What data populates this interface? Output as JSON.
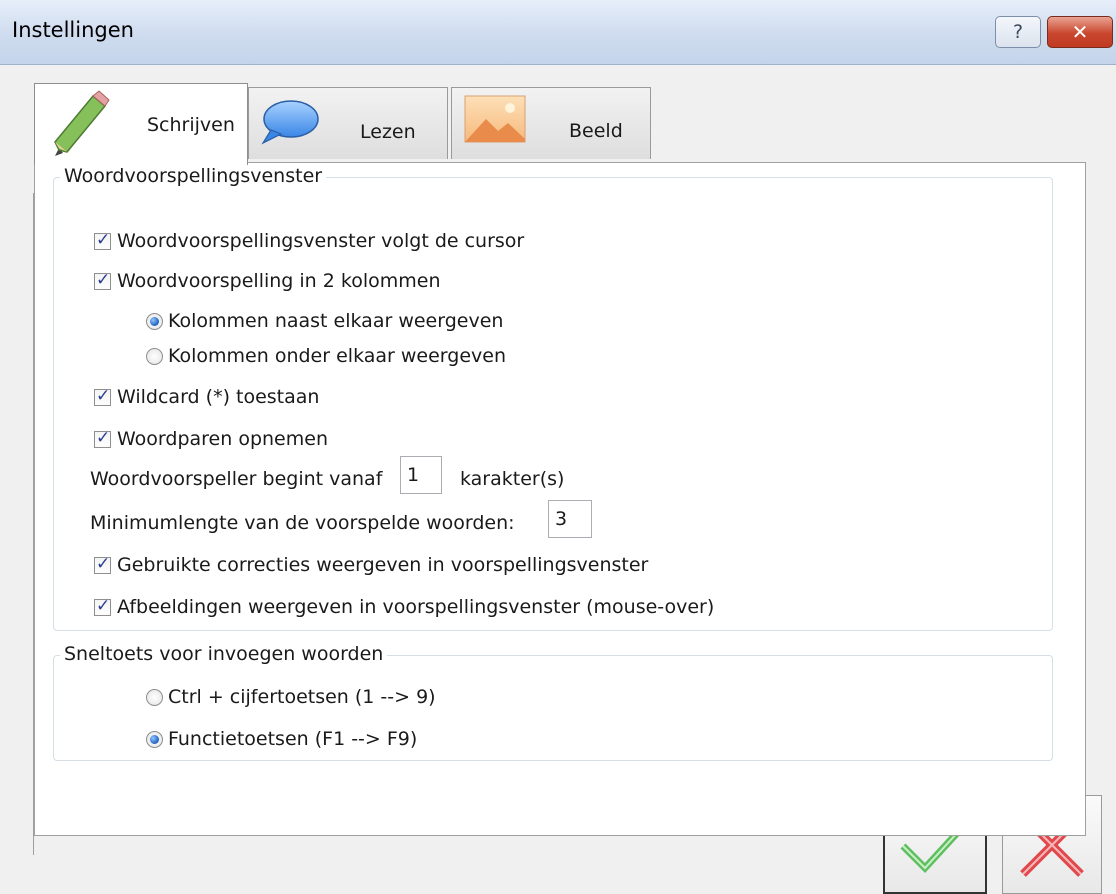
{
  "window": {
    "title": "Instellingen",
    "help_glyph": "?",
    "close_glyph": "✕"
  },
  "tabs": [
    {
      "label": "Schrijven",
      "icon": "pencil-icon",
      "active": true
    },
    {
      "label": "Lezen",
      "icon": "speech-bubble-icon",
      "active": false
    },
    {
      "label": "Beeld",
      "icon": "image-icon",
      "active": false
    }
  ],
  "prediction_group": {
    "legend": "Woordvoorspellingsvenster",
    "follow_cursor": {
      "label": "Woordvoorspellingsvenster volgt de cursor",
      "checked": true
    },
    "two_columns": {
      "label": "Woordvoorspelling in 2 kolommen",
      "checked": true
    },
    "columns_side": {
      "label": "Kolommen naast elkaar weergeven",
      "selected": true
    },
    "columns_below": {
      "label": "Kolommen onder elkaar weergeven",
      "selected": false
    },
    "wildcard": {
      "label": "Wildcard (*) toestaan",
      "checked": true
    },
    "word_pairs": {
      "label": "Woordparen opnemen",
      "checked": true
    },
    "start_from": {
      "label": "Woordvoorspeller begint vanaf",
      "value": "1",
      "suffix": "karakter(s)"
    },
    "min_length": {
      "label": "Minimumlengte van de voorspelde woorden:",
      "value": "3"
    },
    "corrections": {
      "label": "Gebruikte correcties weergeven in voorspellingsvenster",
      "checked": true
    },
    "images": {
      "label": "Afbeeldingen weergeven in voorspellingsvenster (mouse-over)",
      "checked": true
    }
  },
  "hotkey_group": {
    "legend": "Sneltoets voor invoegen woorden",
    "ctrl_digits": {
      "label": "Ctrl + cijfertoetsen (1 --> 9)",
      "selected": false
    },
    "function_keys": {
      "label": "Functietoetsen (F1 --> F9)",
      "selected": true
    }
  },
  "colors": {
    "ok_check": "#5fbf5f",
    "cancel_x": "#e0484b",
    "checkmark": "#2b3d8f",
    "radio_on": "#1d5fbf"
  }
}
